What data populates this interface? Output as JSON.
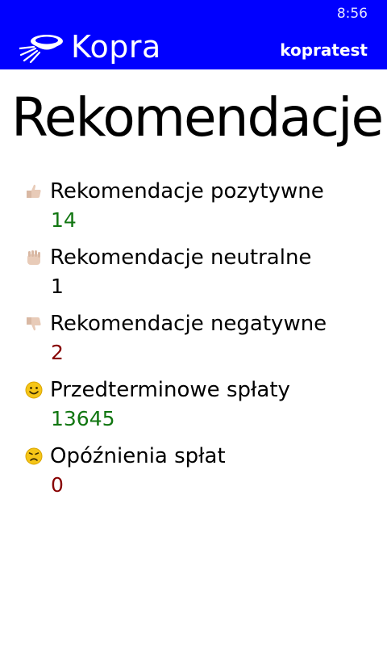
{
  "status_bar": {
    "time": "8:56"
  },
  "header": {
    "app_name": "Kopra",
    "username": "kopratest",
    "background_color": "#0000ff"
  },
  "page": {
    "title": "Rekomendacje Fi"
  },
  "stats": [
    {
      "icon": "thumbs-up-icon",
      "label": "Rekomendacje pozytywne",
      "value": "14",
      "value_color": "#117611"
    },
    {
      "icon": "neutral-hand-icon",
      "label": "Rekomendacje neutralne",
      "value": "1",
      "value_color": "#000000"
    },
    {
      "icon": "thumbs-down-icon",
      "label": "Rekomendacje negatywne",
      "value": "2",
      "value_color": "#870000"
    },
    {
      "icon": "smiley-icon",
      "label": "Przedterminowe spłaty",
      "value": "13645",
      "value_color": "#117611"
    },
    {
      "icon": "sad-face-icon",
      "label": "Opóźnienia spłat",
      "value": "0",
      "value_color": "#870000"
    }
  ]
}
